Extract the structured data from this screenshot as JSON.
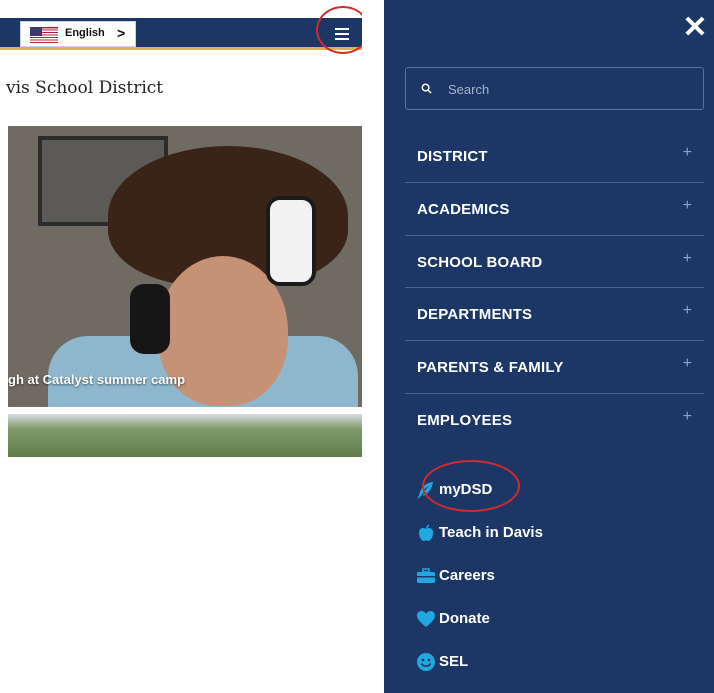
{
  "left": {
    "language": {
      "label": "English",
      "chevron": ">"
    },
    "site_title": "vis School District",
    "photo_caption": "gh at Catalyst summer camp"
  },
  "menu": {
    "close_glyph": "✕",
    "search": {
      "placeholder": "Search"
    },
    "items": [
      {
        "label": "DISTRICT",
        "expand": "+"
      },
      {
        "label": "ACADEMICS",
        "expand": "+"
      },
      {
        "label": "SCHOOL BOARD",
        "expand": "+"
      },
      {
        "label": "DEPARTMENTS",
        "expand": "+"
      },
      {
        "label": "PARENTS & FAMILY",
        "expand": "+"
      },
      {
        "label": "EMPLOYEES",
        "expand": "+"
      }
    ],
    "quick_links": [
      {
        "label": "myDSD",
        "icon": "feather-icon"
      },
      {
        "label": "Teach in Davis",
        "icon": "apple-icon"
      },
      {
        "label": "Careers",
        "icon": "briefcase-icon"
      },
      {
        "label": "Donate",
        "icon": "heart-icon"
      },
      {
        "label": "SEL",
        "icon": "smiley-icon"
      }
    ]
  },
  "colors": {
    "navy": "#1c3666",
    "gold": "#d9b54a",
    "icon_cyan": "#20a8df",
    "annotation_red": "#d12b2b"
  }
}
